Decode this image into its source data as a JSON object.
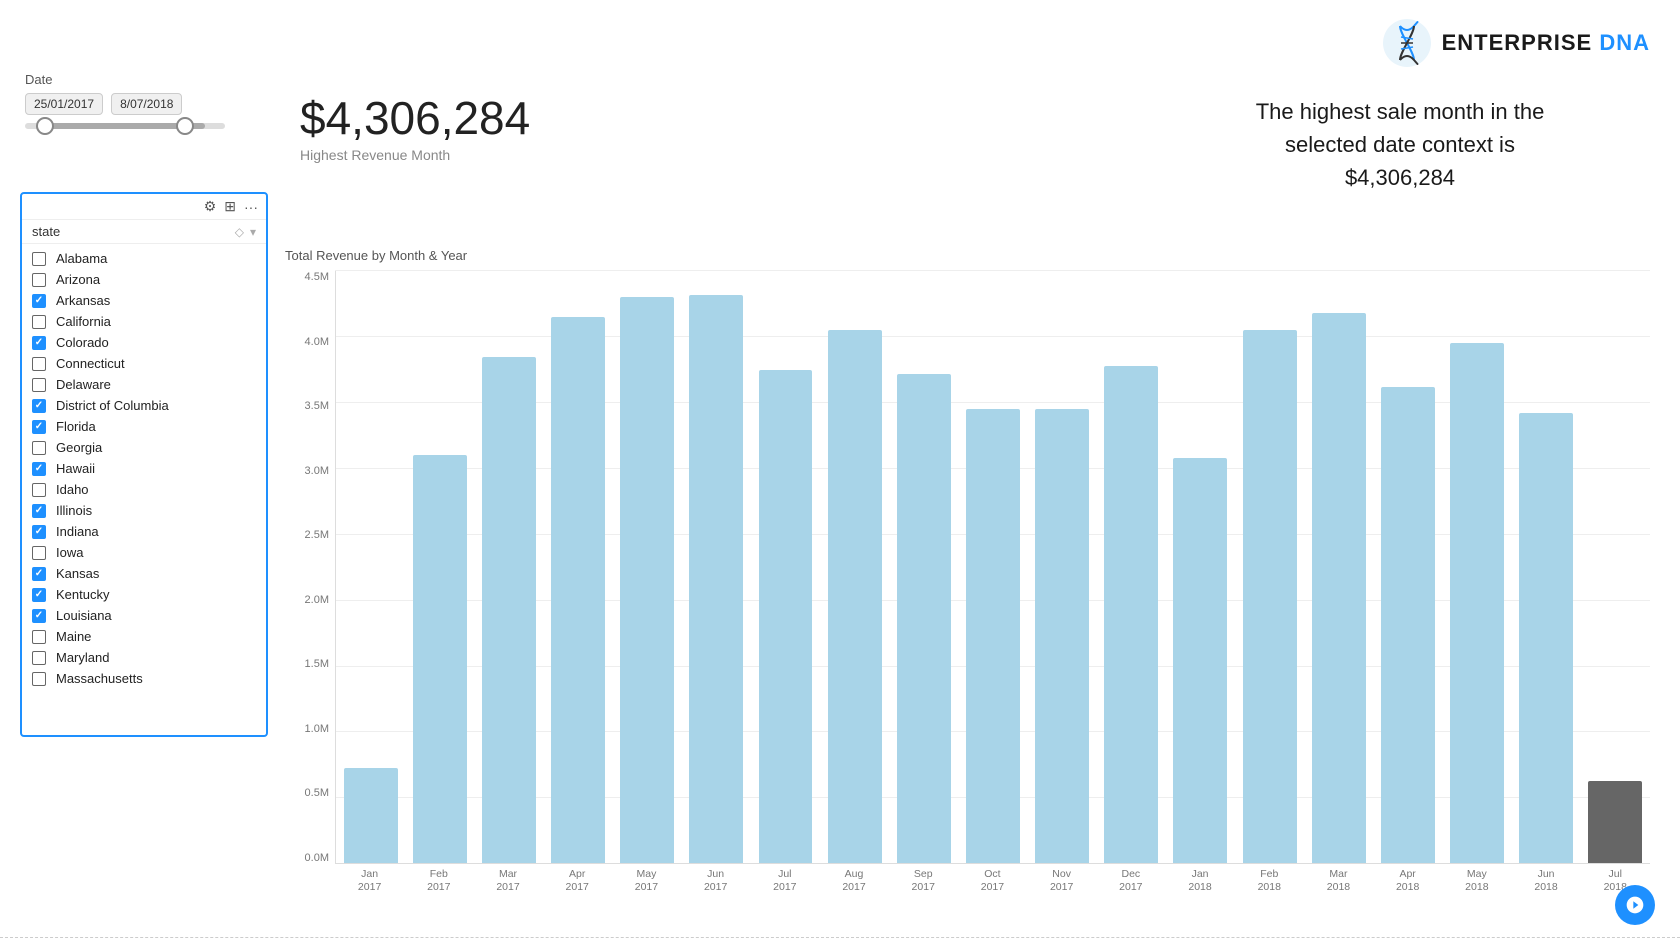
{
  "logo": {
    "text_enterprise": "ENTERPRISE",
    "text_dna": " DNA",
    "alt": "Enterprise DNA Logo"
  },
  "date_filter": {
    "label": "Date",
    "start_date": "25/01/2017",
    "end_date": "8/07/2018"
  },
  "state_panel": {
    "header_label": "state",
    "states": [
      {
        "name": "Alabama",
        "checked": false
      },
      {
        "name": "Arizona",
        "checked": false
      },
      {
        "name": "Arkansas",
        "checked": true
      },
      {
        "name": "California",
        "checked": false
      },
      {
        "name": "Colorado",
        "checked": true
      },
      {
        "name": "Connecticut",
        "checked": false
      },
      {
        "name": "Delaware",
        "checked": false
      },
      {
        "name": "District of Columbia",
        "checked": true
      },
      {
        "name": "Florida",
        "checked": true
      },
      {
        "name": "Georgia",
        "checked": false
      },
      {
        "name": "Hawaii",
        "checked": true
      },
      {
        "name": "Idaho",
        "checked": false
      },
      {
        "name": "Illinois",
        "checked": true
      },
      {
        "name": "Indiana",
        "checked": true
      },
      {
        "name": "Iowa",
        "checked": false
      },
      {
        "name": "Kansas",
        "checked": true
      },
      {
        "name": "Kentucky",
        "checked": true
      },
      {
        "name": "Louisiana",
        "checked": true
      },
      {
        "name": "Maine",
        "checked": false
      },
      {
        "name": "Maryland",
        "checked": false
      },
      {
        "name": "Massachusetts",
        "checked": false
      }
    ]
  },
  "kpi": {
    "value": "$4,306,284",
    "label": "Highest Revenue Month"
  },
  "insight": {
    "line1": "The highest sale month in the",
    "line2": "selected date context is",
    "value": "$4,306,284"
  },
  "chart": {
    "title": "Total Revenue by Month & Year",
    "y_labels": [
      "4.5M",
      "4.0M",
      "3.5M",
      "3.0M",
      "2.5M",
      "2.0M",
      "1.5M",
      "1.0M",
      "0.5M",
      "0.0M"
    ],
    "bars": [
      {
        "month": "Jan",
        "year": "2017",
        "value": 0.72,
        "dark": false
      },
      {
        "month": "Feb",
        "year": "2017",
        "value": 3.1,
        "dark": false
      },
      {
        "month": "Mar",
        "year": "2017",
        "value": 3.85,
        "dark": false
      },
      {
        "month": "Apr",
        "year": "2017",
        "value": 4.15,
        "dark": false
      },
      {
        "month": "May",
        "year": "2017",
        "value": 4.3,
        "dark": false
      },
      {
        "month": "Jun",
        "year": "2017",
        "value": 4.32,
        "dark": false
      },
      {
        "month": "Jul",
        "year": "2017",
        "value": 3.75,
        "dark": false
      },
      {
        "month": "Aug",
        "year": "2017",
        "value": 4.05,
        "dark": false
      },
      {
        "month": "Sep",
        "year": "2017",
        "value": 3.72,
        "dark": false
      },
      {
        "month": "Oct",
        "year": "2017",
        "value": 3.45,
        "dark": false
      },
      {
        "month": "Nov",
        "year": "2017",
        "value": 3.45,
        "dark": false
      },
      {
        "month": "Dec",
        "year": "2017",
        "value": 3.78,
        "dark": false
      },
      {
        "month": "Jan",
        "year": "2018",
        "value": 3.08,
        "dark": false
      },
      {
        "month": "Feb",
        "year": "2018",
        "value": 4.05,
        "dark": false
      },
      {
        "month": "Mar",
        "year": "2018",
        "value": 4.18,
        "dark": false
      },
      {
        "month": "Apr",
        "year": "2018",
        "value": 3.62,
        "dark": false
      },
      {
        "month": "May",
        "year": "2018",
        "value": 3.95,
        "dark": false
      },
      {
        "month": "Jun",
        "year": "2018",
        "value": 3.42,
        "dark": false
      },
      {
        "month": "Jul",
        "year": "2018",
        "value": 0.62,
        "dark": true
      }
    ],
    "max_value": 4.5
  }
}
